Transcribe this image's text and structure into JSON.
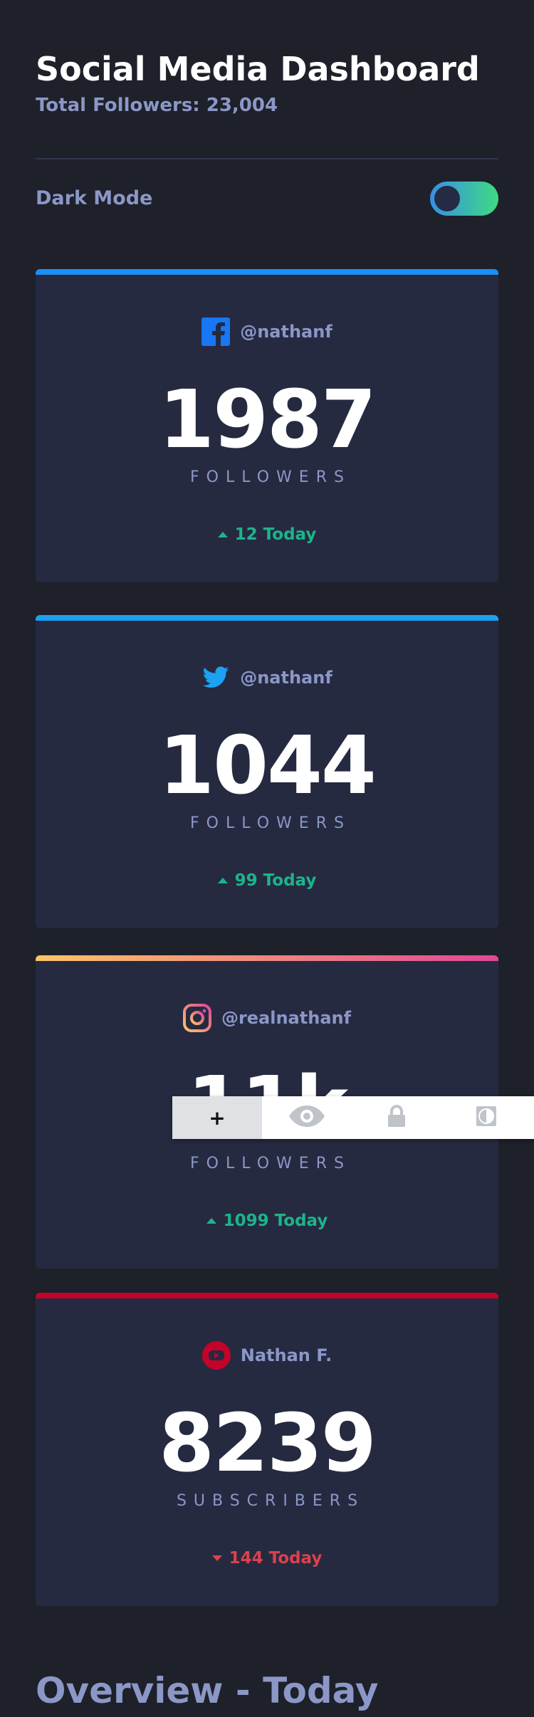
{
  "header": {
    "title": "Social Media Dashboard",
    "total_followers": "Total Followers: 23,004"
  },
  "mode": {
    "label": "Dark Mode",
    "enabled": true
  },
  "cards": [
    {
      "platform": "facebook",
      "icon": "facebook-icon",
      "accent": "#198ff5",
      "handle": "@nathanf",
      "count": "1987",
      "unit": "FOLLOWERS",
      "trend": "up",
      "today": "12 Today"
    },
    {
      "platform": "twitter",
      "icon": "twitter-icon",
      "accent": "#1ca0f2",
      "handle": "@nathanf",
      "count": "1044",
      "unit": "FOLLOWERS",
      "trend": "up",
      "today": "99 Today"
    },
    {
      "platform": "instagram",
      "icon": "instagram-icon",
      "accent": "#fdc468",
      "handle": "@realnathanf",
      "count": "11k",
      "unit": "FOLLOWERS",
      "trend": "up",
      "today": "1099 Today"
    },
    {
      "platform": "youtube",
      "icon": "youtube-icon",
      "accent": "#c4032a",
      "handle": "Nathan F.",
      "count": "8239",
      "unit": "SUBSCRIBERS",
      "trend": "down",
      "today": "144 Today"
    }
  ],
  "overview": {
    "title": "Overview - Today"
  },
  "toolbar": {
    "add_label": "+",
    "tools": [
      "add-icon",
      "eye-icon",
      "lock-icon",
      "contrast-icon"
    ]
  },
  "colors": {
    "background": "#1e202a",
    "card": "#252a41",
    "muted_text": "#8b97c6",
    "up": "#1db489",
    "down": "#dc414c",
    "toggle_start": "#378fe6",
    "toggle_end": "#3eda82"
  }
}
